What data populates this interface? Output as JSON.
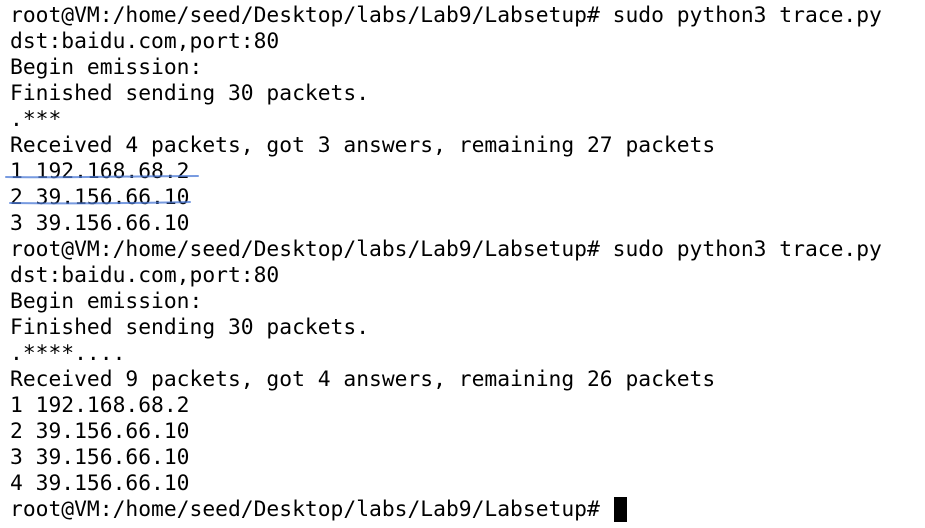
{
  "terminal": {
    "lines": [
      "root@VM:/home/seed/Desktop/labs/Lab9/Labsetup# sudo python3 trace.py",
      "dst:baidu.com,port:80",
      "Begin emission:",
      "Finished sending 30 packets.",
      ".***",
      "Received 4 packets, got 3 answers, remaining 27 packets",
      "1 192.168.68.2",
      "2 39.156.66.10",
      "3 39.156.66.10",
      "root@VM:/home/seed/Desktop/labs/Lab9/Labsetup# sudo python3 trace.py",
      "dst:baidu.com,port:80",
      "Begin emission:",
      "Finished sending 30 packets.",
      ".****....",
      "Received 9 packets, got 4 answers, remaining 26 packets",
      "1 192.168.68.2",
      "2 39.156.66.10",
      "3 39.156.66.10",
      "4 39.156.66.10"
    ],
    "prompt": "root@VM:/home/seed/Desktop/labs/Lab9/Labsetup# ",
    "text_color": "#000000",
    "background_color": "#ffffff",
    "annotation_color": "#4a78d6"
  }
}
